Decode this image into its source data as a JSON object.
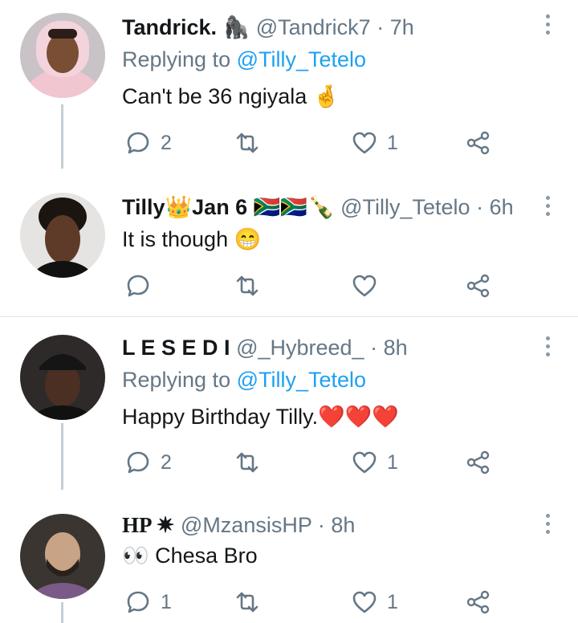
{
  "tweets": [
    {
      "name": "Tandrick.",
      "badge": "🦍",
      "handle": "@Tandrick7",
      "time": "7h",
      "reply_prefix": "Replying to",
      "reply_to": "@Tilly_Tetelo",
      "text": "Can't be 36 ngiyala ",
      "emoji": "🤞",
      "replies": "2",
      "retweets": "",
      "likes": "1"
    },
    {
      "name": "Tilly",
      "badge": "👑",
      "name_suffix": "Jan 6",
      "flags": "🇿🇦🇿🇦🍾",
      "handle": "@Tilly_Tetelo",
      "time": "6h",
      "text": "It is though ",
      "emoji": "😁",
      "replies": "",
      "retweets": "",
      "likes": ""
    },
    {
      "name": "L E S E D I",
      "handle": "@_Hybreed_",
      "time": "8h",
      "reply_prefix": "Replying to",
      "reply_to": "@Tilly_Tetelo",
      "text": "Happy Birthday Tilly.",
      "emoji": "❤️❤️❤️",
      "replies": "2",
      "retweets": "",
      "likes": "1"
    },
    {
      "name": "HP ✷",
      "handle": "@MzansisHP",
      "time": "8h",
      "emoji": "👀",
      "text": " Chesa Bro",
      "replies": "1",
      "retweets": "",
      "likes": "1"
    }
  ],
  "separator": "·",
  "icons": [
    "reply-icon",
    "retweet-icon",
    "like-icon",
    "share-icon",
    "more-icon"
  ],
  "colors": {
    "link": "#1da1f2",
    "secondary": "#657786",
    "thread": "#c4cfd6"
  }
}
